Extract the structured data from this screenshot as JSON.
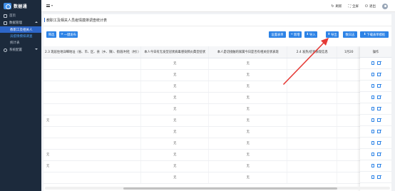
{
  "sidebar": {
    "logo_text": "数据通",
    "items": [
      {
        "label": "首页",
        "icon": "home-icon"
      },
      {
        "label": "数据管理",
        "icon": "data-icon",
        "expanded": true,
        "children": [
          {
            "label": "教职工及相关人",
            "active": true
          },
          {
            "label": "员疫情摸排调查",
            "highlight": true
          },
          {
            "label": "统计表"
          }
        ]
      },
      {
        "label": "系统配置",
        "icon": "gear-icon",
        "expanded": false
      }
    ]
  },
  "header": {
    "refresh_label": "刷新",
    "fullscreen_label": "全屏",
    "logout_label": "退出"
  },
  "page": {
    "title": "教职工及相关人员疫情摸排调查统计表"
  },
  "toolbar": {
    "filter_label": "筛选",
    "onekey_label": "一键发布",
    "settings_label": "设置表单",
    "add_label": "新增",
    "import_label": "导入",
    "export_label": "导出",
    "review_label": "数日志",
    "download_label": "下载表单模板"
  },
  "table": {
    "columns": [
      "2.3 现居住地详细地址（省、市、区、县（乡、镇）、街道/村社（村））",
      "本人今日有无发型冠状病毒感染肺炎典型症状",
      "本人是切接触的家属今日是否有相关症状表现",
      "2.4 发热/症状表现信息",
      "1月20",
      "操作"
    ],
    "rows": [
      [
        "",
        "无",
        "无",
        "",
        ""
      ],
      [
        "",
        "无",
        "无",
        "",
        ""
      ],
      [
        "",
        "无",
        "无",
        "",
        ""
      ],
      [
        "",
        "无",
        "无",
        "",
        ""
      ],
      [
        "",
        "无",
        "无",
        "",
        ""
      ],
      [
        "元",
        "无",
        "无",
        "",
        ""
      ],
      [
        "",
        "无",
        "无",
        "",
        ""
      ],
      [
        "",
        "无",
        "无",
        "",
        ""
      ],
      [
        "元",
        "无",
        "无",
        "",
        ""
      ],
      [
        "元",
        "无",
        "无",
        "",
        ""
      ],
      [
        "",
        "无",
        "无",
        "",
        ""
      ]
    ]
  },
  "colors": {
    "sidebar_bg": "#1c2a3c",
    "accent": "#2d83e6",
    "active_item": "#2d66c9",
    "annotation_arrow": "#e53935"
  }
}
